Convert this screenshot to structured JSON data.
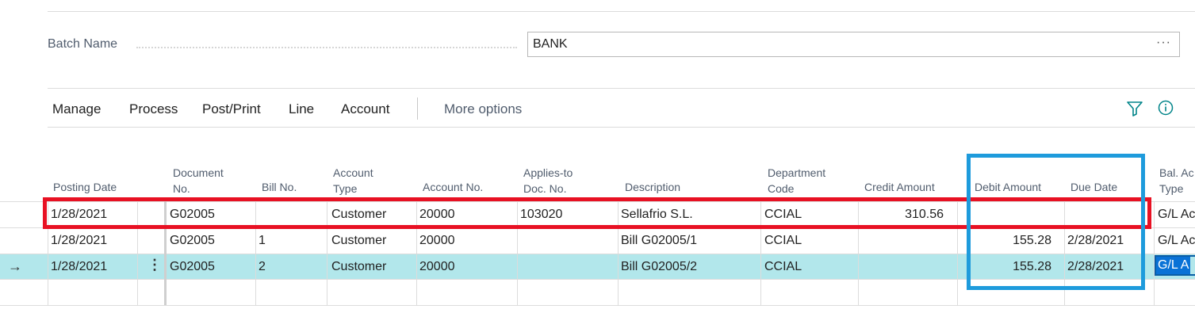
{
  "batch": {
    "label": "Batch Name",
    "value": "BANK",
    "more": "···"
  },
  "actions": [
    "Manage",
    "Process",
    "Post/Print",
    "Line",
    "Account"
  ],
  "more_options": "More options",
  "columns": {
    "posting_date": "Posting Date",
    "document_no": [
      "Document",
      "No."
    ],
    "bill_no": "Bill No.",
    "account_type": [
      "Account",
      "Type"
    ],
    "account_no": "Account No.",
    "applies_to": [
      "Applies-to",
      "Doc. No."
    ],
    "description": "Description",
    "department": [
      "Department",
      "Code"
    ],
    "credit_amount": "Credit Amount",
    "debit_amount": "Debit Amount",
    "due_date": "Due Date",
    "bal_account": [
      "Bal. Ac",
      "Type"
    ]
  },
  "rows": [
    {
      "posting_date": "1/28/2021",
      "document_no": "G02005",
      "bill_no": "",
      "account_type": "Customer",
      "account_no": "20000",
      "applies_to": "103020",
      "description": "Sellafrio S.L.",
      "department": "CCIAL",
      "credit_amount": "310.56",
      "debit_amount": "",
      "due_date": "",
      "bal_account": "G/L Ac"
    },
    {
      "posting_date": "1/28/2021",
      "document_no": "G02005",
      "bill_no": "1",
      "account_type": "Customer",
      "account_no": "20000",
      "applies_to": "",
      "description": "Bill G02005/1",
      "department": "CCIAL",
      "credit_amount": "",
      "debit_amount": "155.28",
      "due_date": "2/28/2021",
      "bal_account": "G/L Ac"
    },
    {
      "posting_date": "1/28/2021",
      "document_no": "G02005",
      "bill_no": "2",
      "account_type": "Customer",
      "account_no": "20000",
      "applies_to": "",
      "description": "Bill G02005/2",
      "department": "CCIAL",
      "credit_amount": "",
      "debit_amount": "155.28",
      "due_date": "2/28/2021",
      "bal_account": "G/L A"
    }
  ],
  "row_arrow": "→",
  "row_menu": "⋮",
  "colors": {
    "selected_row": "#b2e7eb",
    "highlight_red": "#e81123",
    "highlight_blue": "#1e9bdc",
    "accent": "#008489"
  }
}
